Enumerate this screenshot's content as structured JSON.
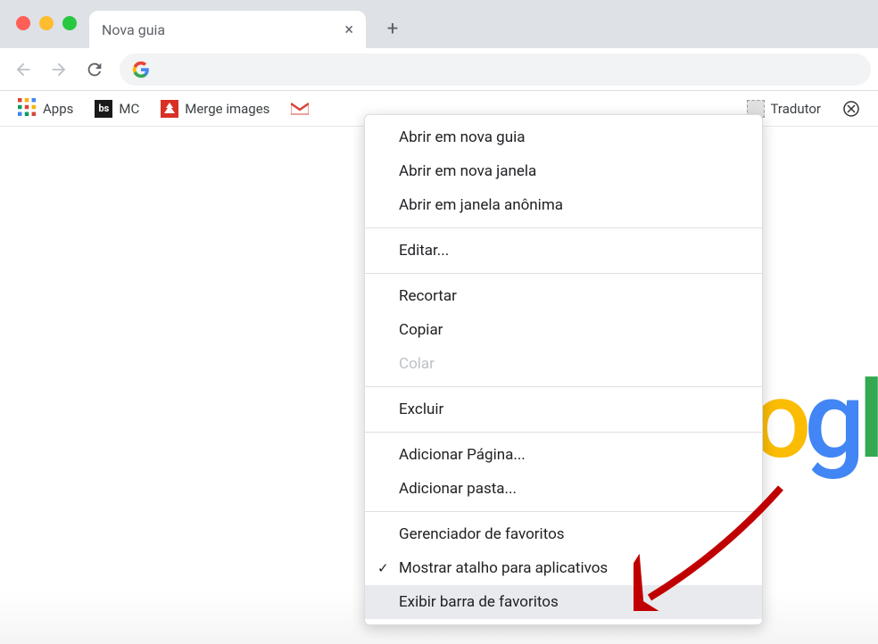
{
  "titlebar": {
    "tab_title": "Nova guia"
  },
  "bookmarks": {
    "apps_label": "Apps",
    "items": [
      {
        "label": "MC",
        "icon": "bs"
      },
      {
        "label": "Merge images",
        "icon": "red-tree"
      },
      {
        "label": "",
        "icon": "gmail"
      }
    ],
    "tradutor_label": "Tradutor"
  },
  "context_menu": {
    "groups": [
      [
        {
          "label": "Abrir em nova guia",
          "enabled": true
        },
        {
          "label": "Abrir em nova janela",
          "enabled": true
        },
        {
          "label": "Abrir em janela anônima",
          "enabled": true
        }
      ],
      [
        {
          "label": "Editar...",
          "enabled": true
        }
      ],
      [
        {
          "label": "Recortar",
          "enabled": true
        },
        {
          "label": "Copiar",
          "enabled": true
        },
        {
          "label": "Colar",
          "enabled": false
        }
      ],
      [
        {
          "label": "Excluir",
          "enabled": true
        }
      ],
      [
        {
          "label": "Adicionar Página...",
          "enabled": true
        },
        {
          "label": "Adicionar pasta...",
          "enabled": true
        }
      ],
      [
        {
          "label": "Gerenciador de favoritos",
          "enabled": true
        },
        {
          "label": "Mostrar atalho para aplicativos",
          "enabled": true,
          "checked": true
        },
        {
          "label": "Exibir barra de favoritos",
          "enabled": true,
          "highlighted": true
        }
      ]
    ]
  },
  "google_logo_partial": {
    "o": "o",
    "g": "g",
    "l": "l"
  }
}
